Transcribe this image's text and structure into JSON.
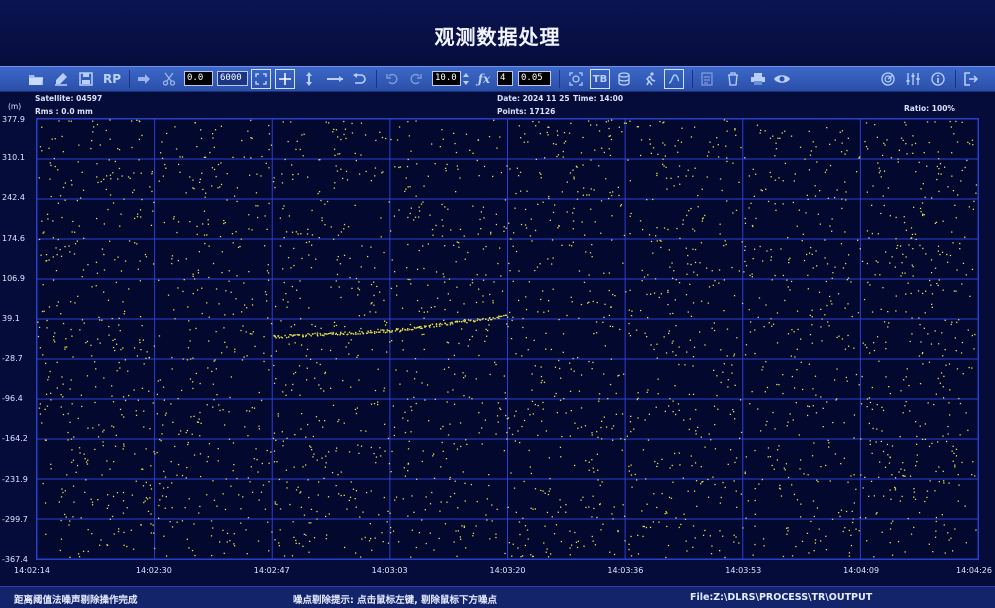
{
  "window": {
    "title": "观测数据处理"
  },
  "toolbar": {
    "rp_label": "RP",
    "start_value": "0.0",
    "end_value": "6000",
    "step_value": "10.0",
    "fx_order": "4",
    "fx_value": "0.05",
    "tb_label": "TB",
    "colors": {
      "bg": "#3d68c9",
      "icon": "#bcd3ff"
    }
  },
  "info": {
    "satellite": "Satellite: 04597",
    "rms": "Rms :   0.0 mm",
    "date": "Date: 2024 11 25",
    "time": "Time: 14:00",
    "points": "Points: 17126",
    "ratio": "Ratio: 100%",
    "unit": "(m)"
  },
  "chart_data": {
    "type": "scatter",
    "title": "",
    "ylabel": "(m)",
    "xlabel": "",
    "ylim": [
      -367.4,
      377.9
    ],
    "y_ticks": [
      "377.9",
      "310.1",
      "242.4",
      "174.6",
      "106.9",
      "39.1",
      "-28.7",
      "-96.4",
      "-164.2",
      "-231.9",
      "-299.7",
      "-367.4"
    ],
    "x_ticks": [
      "14:02:14",
      "14:02:30",
      "14:02:47",
      "14:03:03",
      "14:03:20",
      "14:03:36",
      "14:03:53",
      "14:04:09",
      "14:04:26"
    ],
    "grid": true,
    "point_color": "#e8e04a",
    "series": [
      {
        "kind": "noise",
        "count": 3000
      },
      {
        "kind": "signal",
        "x": [
          "14:02:47",
          "14:03:03",
          "14:03:20"
        ],
        "y": [
          10,
          20,
          45
        ]
      }
    ]
  },
  "status": {
    "left": "距离阈值法噪声剔除操作完成",
    "middle": "噪点剔除提示: 点击鼠标左键, 剔除鼠标下方噪点",
    "right": "File:Z:\\DLRS\\PROCESS\\TR\\OUTPUT"
  }
}
